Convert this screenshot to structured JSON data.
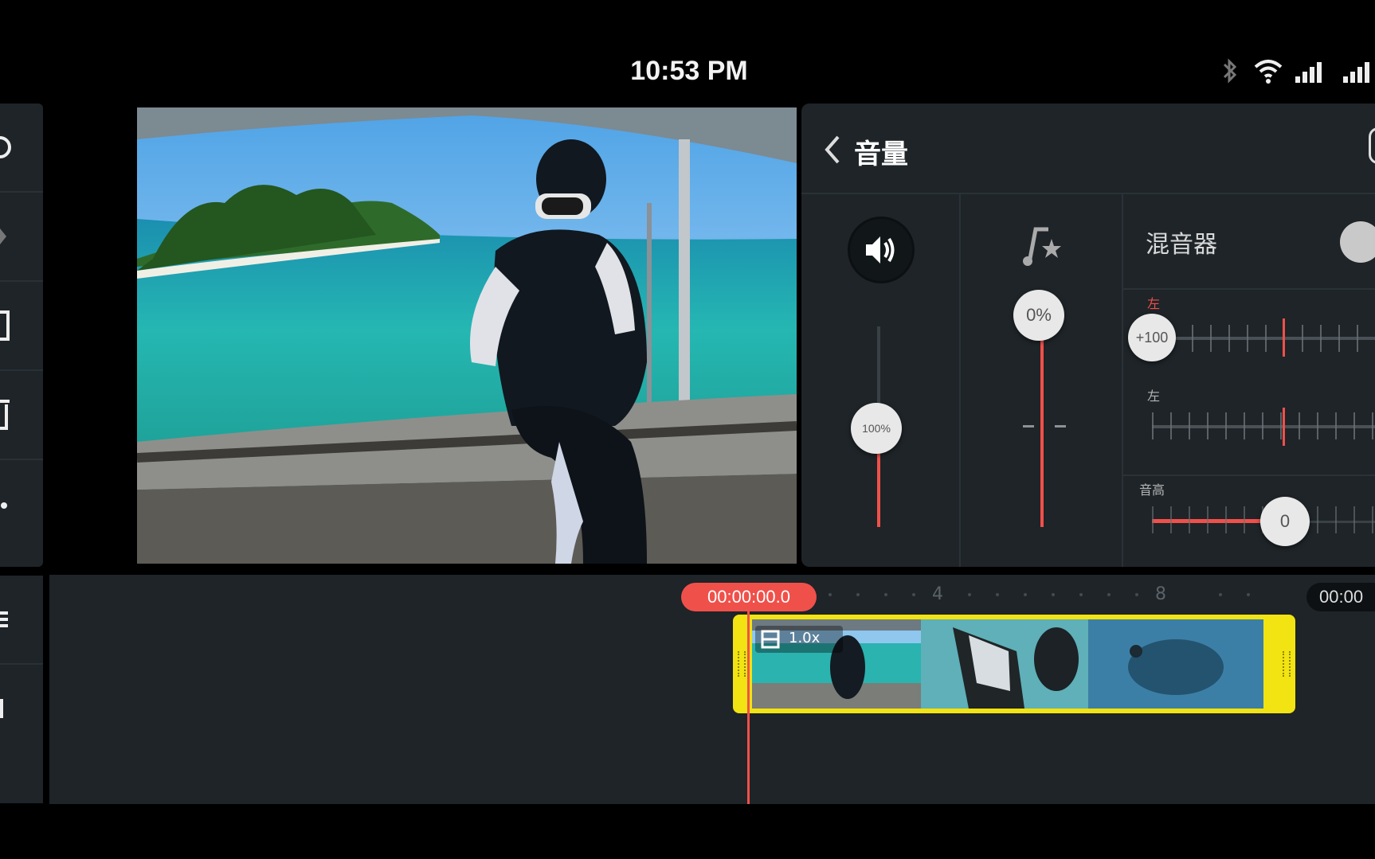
{
  "status_bar": {
    "time": "10:53 PM"
  },
  "volume_panel": {
    "title": "音量",
    "clip_volume_label": "100%",
    "background_music_label": "0%",
    "mixer": {
      "label": "混音器",
      "pan_top_label": "左",
      "pan_top_value": "+100",
      "pan_bottom_label": "左",
      "pitch_label": "音高",
      "pitch_value": "0"
    }
  },
  "timeline": {
    "current_time": "00:00:00.0",
    "end_time": "00:00",
    "ruler_marks": [
      "4",
      "8"
    ],
    "clip_speed_label": "1.0x"
  },
  "colors": {
    "accent_red": "#f0504a",
    "clip_border_yellow": "#f2e312",
    "panel_bg": "#1e2428"
  }
}
